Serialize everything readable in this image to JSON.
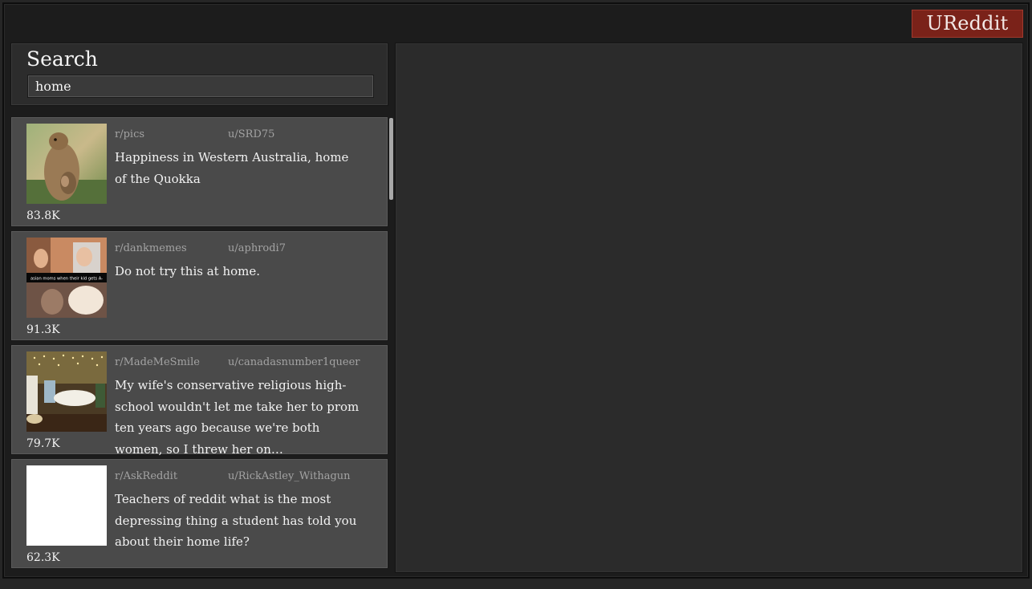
{
  "app": {
    "brand_label": "UReddit"
  },
  "search": {
    "title": "Search",
    "query": "home"
  },
  "results": [
    {
      "subreddit": "r/pics",
      "author": "u/SRD75",
      "title": "Happiness in Western Australia, home of the Quokka",
      "score": "83.8K",
      "thumbnail": "quokka-photo"
    },
    {
      "subreddit": "r/dankmemes",
      "author": "u/aphrodi7",
      "title": "Do not try this at home.",
      "score": "91.3K",
      "thumbnail": "meme-image",
      "thumbnail_caption": "asian moms when their kid gets A-"
    },
    {
      "subreddit": "r/MadeMeSmile",
      "author": "u/canadasnumber1queer",
      "title": "My wife's conservative religious high-school wouldn't let me take her to prom ten years ago because we're both women, so I threw her on…",
      "score": "79.7K",
      "thumbnail": "decorated-room-photo"
    },
    {
      "subreddit": "r/AskReddit",
      "author": "u/RickAstley_Withagun",
      "title": "Teachers of reddit what is the most depressing thing a student has told you about their home life?",
      "score": "62.3K",
      "thumbnail": "blank-white"
    }
  ],
  "colors": {
    "brand": "#7a2219",
    "card": "#4a4a4a",
    "panel": "#2b2b2b",
    "muted_text": "#a3a3a3"
  }
}
